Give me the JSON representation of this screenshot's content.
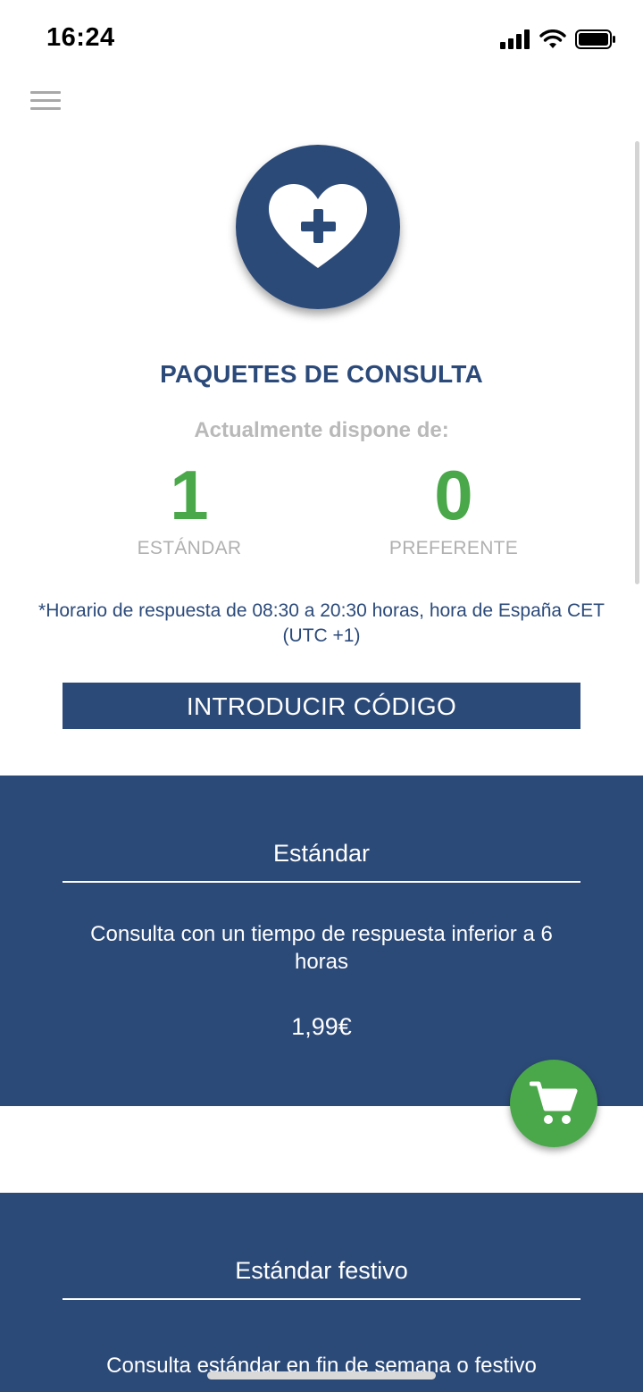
{
  "status_bar": {
    "time": "16:24",
    "icons": [
      "signal-icon",
      "wifi-icon",
      "battery-icon"
    ]
  },
  "header": {
    "menu_icon": "hamburger-menu-icon"
  },
  "logo": {
    "icon": "heart-plus-icon",
    "color": "#2c4a78"
  },
  "main": {
    "title": "PAQUETES DE CONSULTA",
    "subtitle": "Actualmente dispone de:",
    "counters": [
      {
        "value": "1",
        "label": "ESTÁNDAR"
      },
      {
        "value": "0",
        "label": "PREFERENTE"
      }
    ],
    "hours_note": "*Horario de respuesta de 08:30 a 20:30 horas, hora de España CET (UTC +1)",
    "code_button": "INTRODUCIR CÓDIGO"
  },
  "packages": [
    {
      "name": "Estándar",
      "description": "Consulta con un tiempo de respuesta inferior a 6 horas",
      "price": "1,99€"
    },
    {
      "name": "Estándar festivo",
      "description": "Consulta estándar en fin de semana o festivo"
    }
  ],
  "cart_button": {
    "icon": "shopping-cart-icon"
  },
  "colors": {
    "primary": "#2c4a78",
    "accent_green": "#4aa84a",
    "muted_text": "#b0b0b0"
  }
}
